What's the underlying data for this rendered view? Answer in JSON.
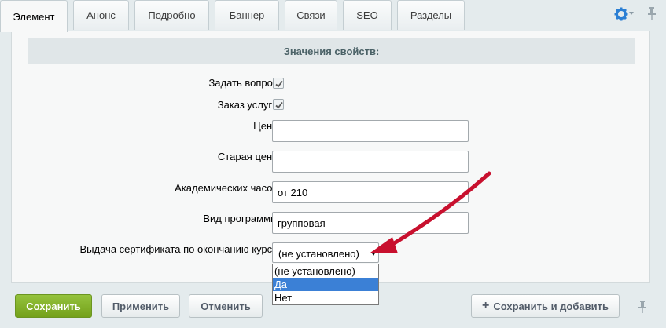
{
  "tabs": [
    "Элемент",
    "Анонс",
    "Подробно",
    "Баннер",
    "Связи",
    "SEO",
    "Разделы"
  ],
  "active_tab": "Элемент",
  "section_title": "Значения свойств:",
  "fields": {
    "ask_question": {
      "label": "Задать вопрос:",
      "checked": true
    },
    "order_service": {
      "label": "Заказ услуги:",
      "checked": true
    },
    "price": {
      "label": "Цена:",
      "value": ""
    },
    "old_price": {
      "label": "Старая цена:",
      "value": ""
    },
    "academic_hours": {
      "label": "Академических часов:",
      "value": "от 210"
    },
    "program_type": {
      "label": "Вид программы:",
      "value": "групповая"
    },
    "certificate": {
      "label": "Выдача сертификата по окончанию курса:",
      "selected": "(не установлено)",
      "options": [
        "(не установлено)",
        "Да",
        "Нет"
      ],
      "highlighted": "Да"
    }
  },
  "buttons": {
    "save": "Сохранить",
    "apply": "Применить",
    "cancel": "Отменить",
    "save_and_add": "Сохранить и добавить"
  },
  "colors": {
    "accent_green": "#7fae25",
    "highlight_blue": "#3b80d6",
    "annotation_arrow": "#c8102e"
  },
  "icons": [
    "gear-icon",
    "pin-icon",
    "checkmark-icon",
    "plus-icon"
  ]
}
